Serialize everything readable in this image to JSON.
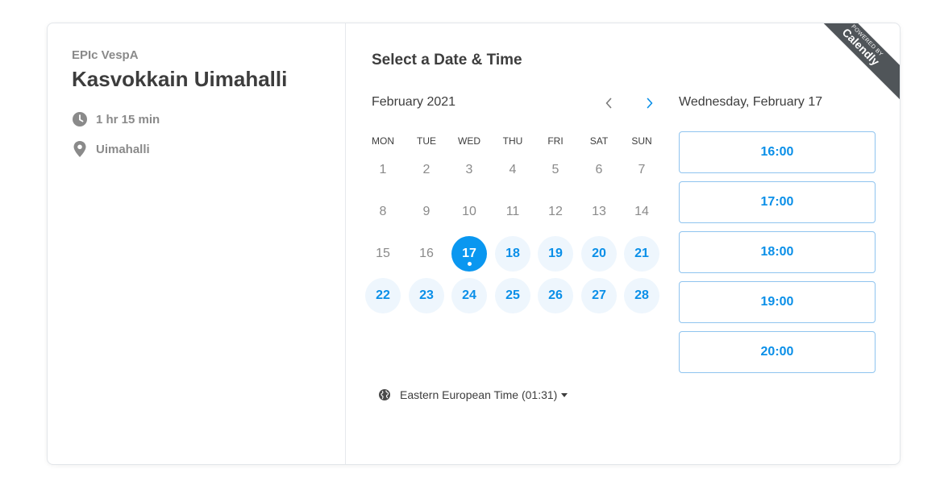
{
  "event": {
    "organizer": "EPIc VespA",
    "title": "Kasvokkain Uimahalli",
    "duration": "1 hr 15 min",
    "location": "Uimahalli"
  },
  "calendar": {
    "heading": "Select a Date & Time",
    "month": "February 2021",
    "weekdays": [
      "MON",
      "TUE",
      "WED",
      "THU",
      "FRI",
      "SAT",
      "SUN"
    ],
    "days": [
      {
        "label": "1",
        "state": "unavailable"
      },
      {
        "label": "2",
        "state": "unavailable"
      },
      {
        "label": "3",
        "state": "unavailable"
      },
      {
        "label": "4",
        "state": "unavailable"
      },
      {
        "label": "5",
        "state": "unavailable"
      },
      {
        "label": "6",
        "state": "unavailable"
      },
      {
        "label": "7",
        "state": "unavailable"
      },
      {
        "label": "8",
        "state": "unavailable"
      },
      {
        "label": "9",
        "state": "unavailable"
      },
      {
        "label": "10",
        "state": "unavailable"
      },
      {
        "label": "11",
        "state": "unavailable"
      },
      {
        "label": "12",
        "state": "unavailable"
      },
      {
        "label": "13",
        "state": "unavailable"
      },
      {
        "label": "14",
        "state": "unavailable"
      },
      {
        "label": "15",
        "state": "unavailable"
      },
      {
        "label": "16",
        "state": "unavailable"
      },
      {
        "label": "17",
        "state": "selected"
      },
      {
        "label": "18",
        "state": "available"
      },
      {
        "label": "19",
        "state": "available"
      },
      {
        "label": "20",
        "state": "available"
      },
      {
        "label": "21",
        "state": "available"
      },
      {
        "label": "22",
        "state": "available"
      },
      {
        "label": "23",
        "state": "available"
      },
      {
        "label": "24",
        "state": "available"
      },
      {
        "label": "25",
        "state": "available"
      },
      {
        "label": "26",
        "state": "available"
      },
      {
        "label": "27",
        "state": "available"
      },
      {
        "label": "28",
        "state": "available"
      }
    ],
    "timezone": "Eastern European Time (01:31)"
  },
  "times": {
    "selected_date": "Wednesday, February 17",
    "slots": [
      "16:00",
      "17:00",
      "18:00",
      "19:00",
      "20:00"
    ]
  },
  "badge": {
    "small_text": "POWERED BY",
    "brand": "Calendly"
  },
  "colors": {
    "accent": "#0a97f0",
    "available_bg": "#eef6fd",
    "slot_border": "#8fc4ef",
    "badge_bg": "#505559"
  },
  "icons": {
    "duration": "clock-icon",
    "location": "location-pin-icon",
    "timezone": "globe-icon",
    "prev": "chevron-left-icon",
    "next": "chevron-right-icon",
    "tz_dropdown": "caret-down-icon"
  }
}
